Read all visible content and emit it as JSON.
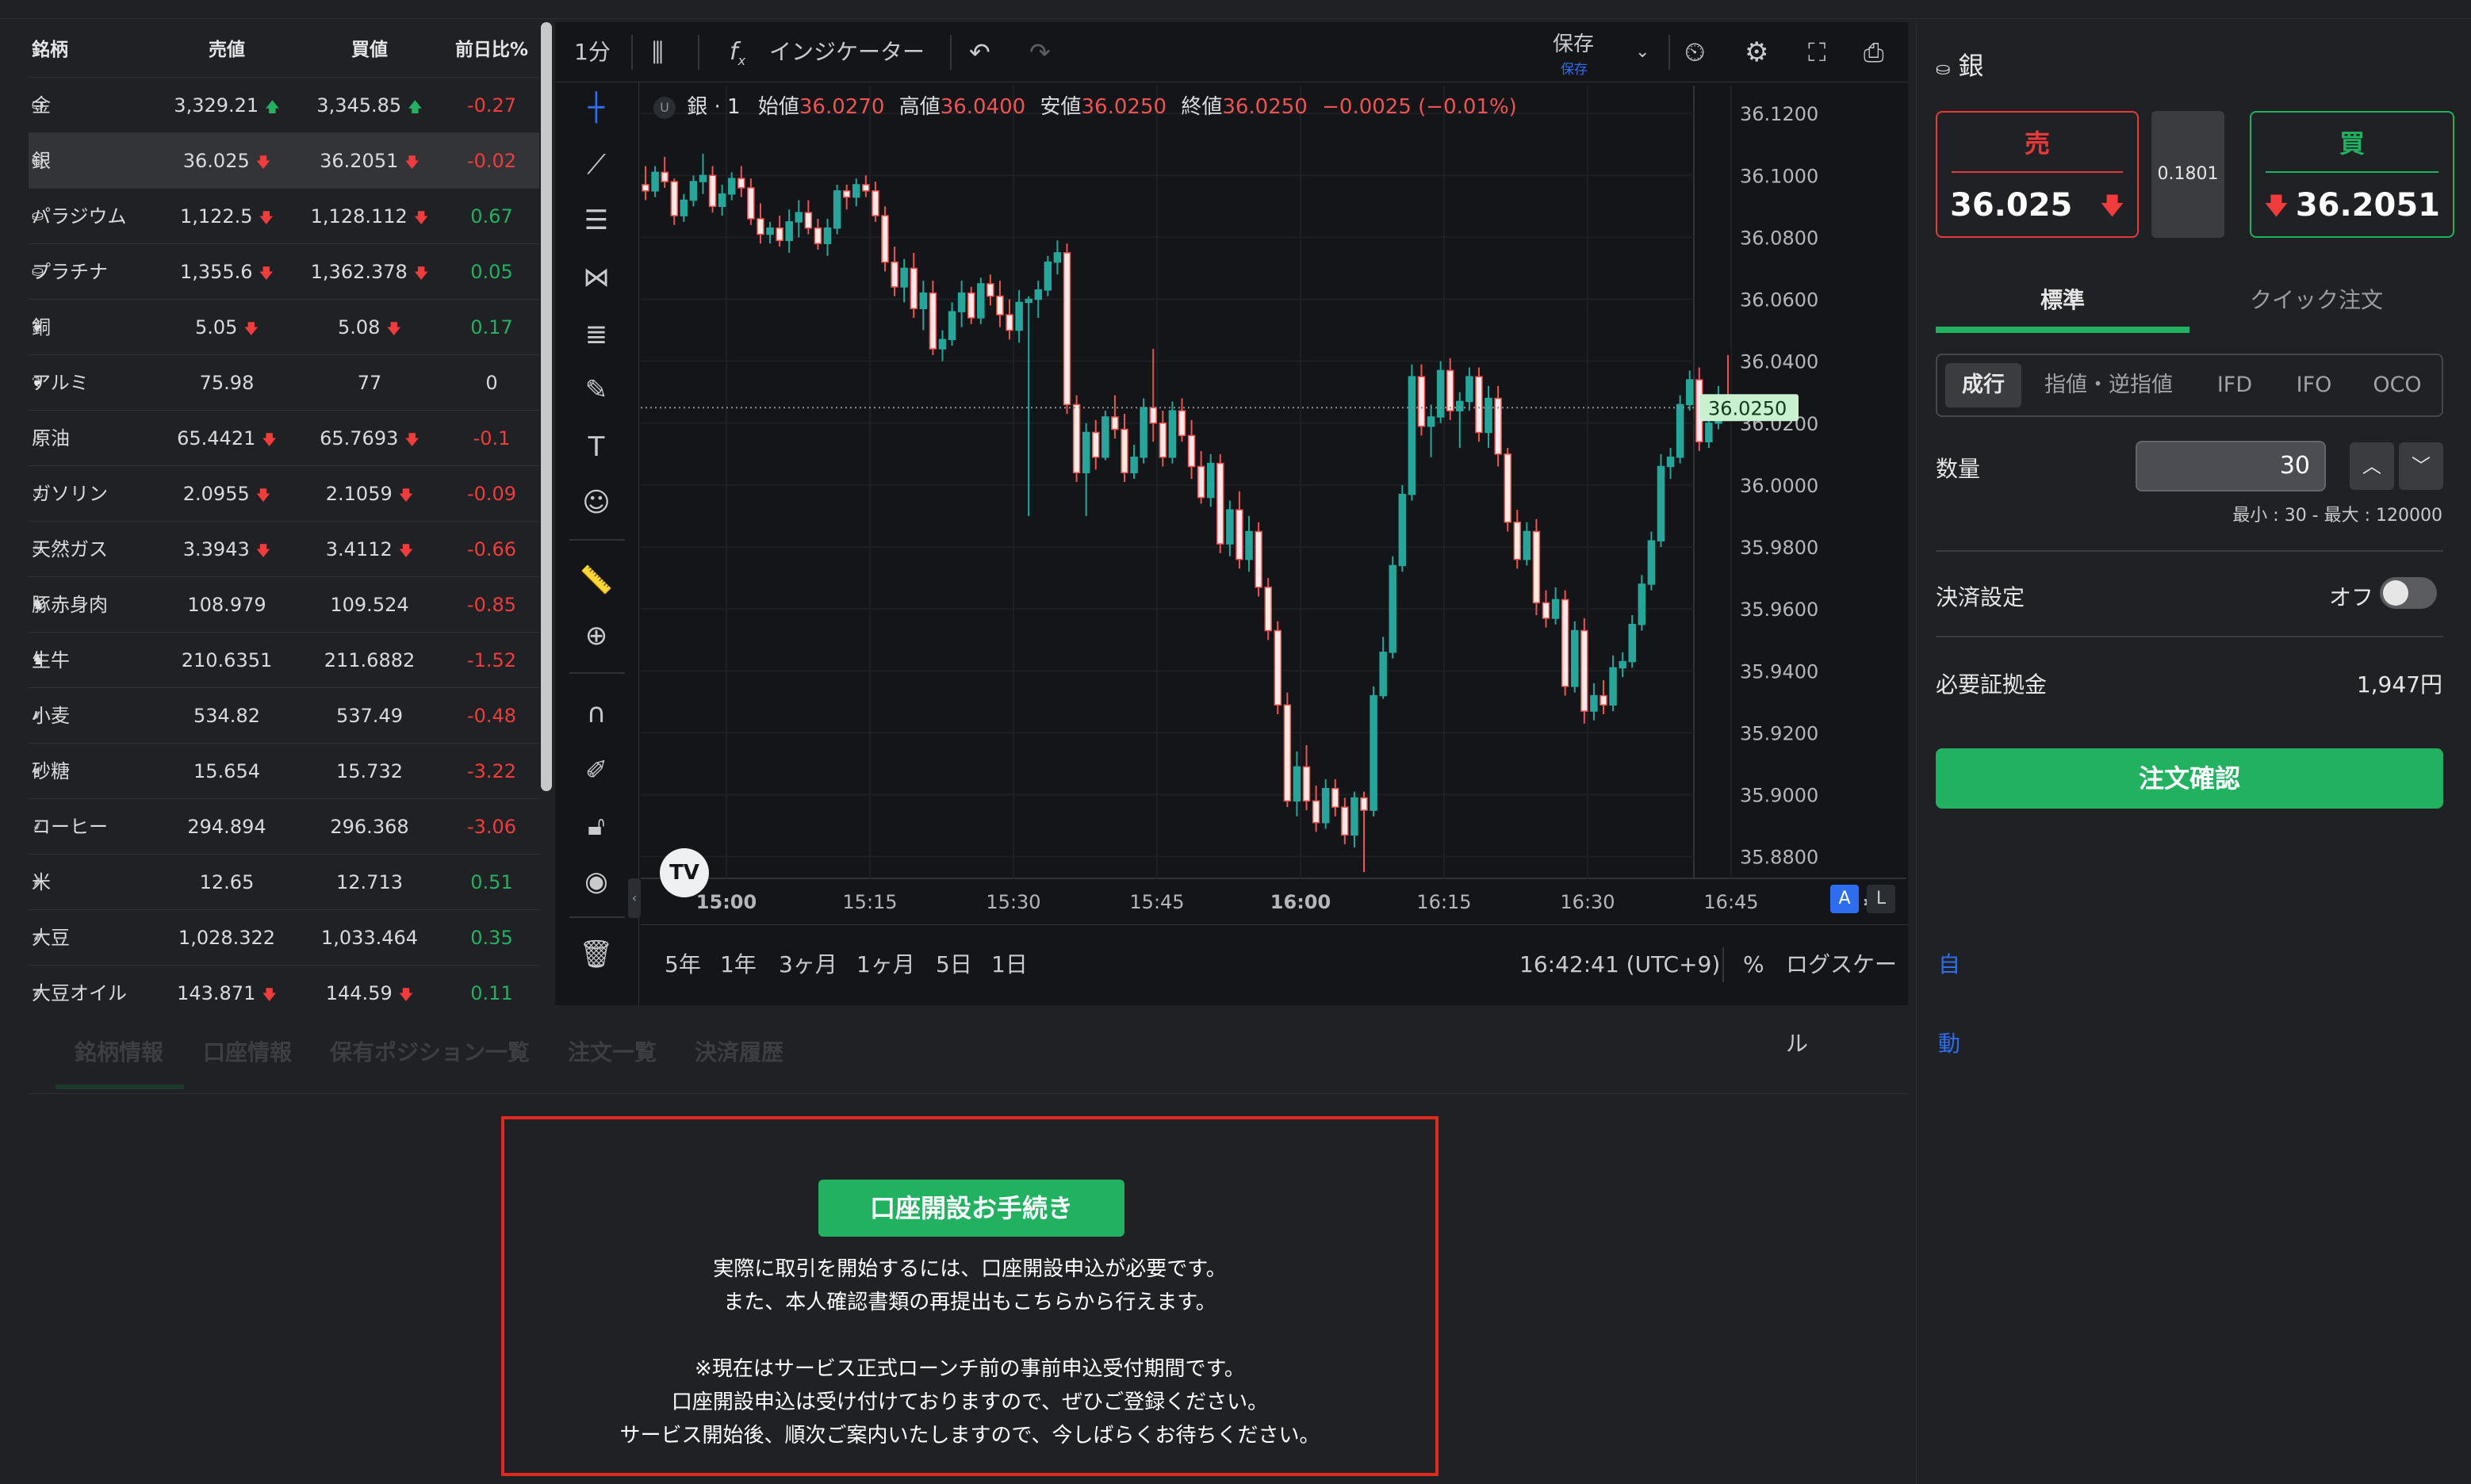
{
  "market": {
    "headers": {
      "name": "銘柄",
      "sell": "売値",
      "buy": "買値",
      "change": "前日比%"
    },
    "rows": [
      {
        "icon": "metal-icon",
        "glyph": "⛀",
        "name": "金",
        "sell": "3,329.21",
        "sell_dir": "▲",
        "buy": "3,345.85",
        "buy_dir": "▲",
        "change": "-0.27"
      },
      {
        "icon": "metal-icon",
        "glyph": "⛀",
        "name": "銀",
        "sell": "36.025",
        "sell_dir": "▼",
        "buy": "36.2051",
        "buy_dir": "▼",
        "change": "-0.02"
      },
      {
        "icon": "metal-icon",
        "glyph": "⛀",
        "name": "パラジウム",
        "sell": "1,122.5",
        "sell_dir": "▼",
        "buy": "1,128.112",
        "buy_dir": "▼",
        "change": "0.67"
      },
      {
        "icon": "metal-icon",
        "glyph": "⛀",
        "name": "プラチナ",
        "sell": "1,355.6",
        "sell_dir": "▼",
        "buy": "1,362.378",
        "buy_dir": "▼",
        "change": "0.05"
      },
      {
        "icon": "coil-icon",
        "glyph": "❦",
        "name": "銅",
        "sell": "5.05",
        "sell_dir": "▼",
        "buy": "5.08",
        "buy_dir": "▼",
        "change": "0.17"
      },
      {
        "icon": "coil-icon",
        "glyph": "❦",
        "name": "アルミ",
        "sell": "75.98",
        "sell_dir": "",
        "buy": "77",
        "buy_dir": "",
        "change": "0"
      },
      {
        "icon": "flame-icon",
        "glyph": "♨",
        "name": "原油",
        "sell": "65.4421",
        "sell_dir": "▼",
        "buy": "65.7693",
        "buy_dir": "▼",
        "change": "-0.1"
      },
      {
        "icon": "flame-icon",
        "glyph": "♨",
        "name": "ガソリン",
        "sell": "2.0955",
        "sell_dir": "▼",
        "buy": "2.1059",
        "buy_dir": "▼",
        "change": "-0.09"
      },
      {
        "icon": "flame-icon",
        "glyph": "♨",
        "name": "天然ガス",
        "sell": "3.3943",
        "sell_dir": "▼",
        "buy": "3.4112",
        "buy_dir": "▼",
        "change": "-0.66"
      },
      {
        "icon": "livestock-icon",
        "glyph": "♞",
        "name": "豚赤身肉",
        "sell": "108.979",
        "sell_dir": "",
        "buy": "109.524",
        "buy_dir": "",
        "change": "-0.85"
      },
      {
        "icon": "livestock-icon",
        "glyph": "♞",
        "name": "生牛",
        "sell": "210.6351",
        "sell_dir": "",
        "buy": "211.6882",
        "buy_dir": "",
        "change": "-1.52"
      },
      {
        "icon": "grain-icon",
        "glyph": "⸙",
        "name": "小麦",
        "sell": "534.82",
        "sell_dir": "",
        "buy": "537.49",
        "buy_dir": "",
        "change": "-0.48"
      },
      {
        "icon": "grain-icon",
        "glyph": "⸙",
        "name": "砂糖",
        "sell": "15.654",
        "sell_dir": "",
        "buy": "15.732",
        "buy_dir": "",
        "change": "-3.22"
      },
      {
        "icon": "grain-icon",
        "glyph": "⸙",
        "name": "コーヒー",
        "sell": "294.894",
        "sell_dir": "",
        "buy": "296.368",
        "buy_dir": "",
        "change": "-3.06"
      },
      {
        "icon": "grain-icon",
        "glyph": "⸙",
        "name": "米",
        "sell": "12.65",
        "sell_dir": "",
        "buy": "12.713",
        "buy_dir": "",
        "change": "0.51"
      },
      {
        "icon": "grain-icon",
        "glyph": "⸙",
        "name": "大豆",
        "sell": "1,028.322",
        "sell_dir": "",
        "buy": "1,033.464",
        "buy_dir": "",
        "change": "0.35"
      },
      {
        "icon": "grain-icon",
        "glyph": "⸙",
        "name": "大豆オイル",
        "sell": "143.871",
        "sell_dir": "▼",
        "buy": "144.59",
        "buy_dir": "▼",
        "change": "0.11"
      }
    ]
  },
  "chart_toolbar": {
    "interval": "1分",
    "indicator": "インジケーター",
    "save": "保存",
    "save_sub": "保存"
  },
  "chart_header": {
    "flag": "U",
    "symbol": "銀 · 1",
    "open_label": "始値",
    "open": "36.0270",
    "high_label": "高値",
    "high": "36.0400",
    "low_label": "安値",
    "low": "36.0250",
    "close_label": "終値",
    "close": "36.0250",
    "change": "−0.0025 (−0.01%)"
  },
  "chart_bottom": {
    "ranges": [
      "5年",
      "1年",
      "3ヶ月",
      "1ヶ月",
      "5日",
      "1日"
    ],
    "time": "16:42:41 (UTC+9)",
    "percent": "%",
    "log": "ログスケール",
    "auto": "自動",
    "scale_a": "A",
    "scale_l": "L"
  },
  "chart_data": {
    "type": "candlestick",
    "current_price": "36.0250",
    "y_ticks": [
      "36.1200",
      "36.1000",
      "36.0800",
      "36.0600",
      "36.0400",
      "36.0200",
      "36.0000",
      "35.9800",
      "35.9600",
      "35.9400",
      "35.9200",
      "35.9000",
      "35.8800"
    ],
    "x_ticks": [
      "15:00",
      "15:15",
      "15:30",
      "15:45",
      "16:00",
      "16:15",
      "16:30",
      "16:45"
    ],
    "ylim": [
      35.873,
      36.129
    ],
    "up_color": "#26a69a",
    "down_color": "#ef5350",
    "ohlc": [
      [
        36.097,
        36.103,
        36.092,
        36.095
      ],
      [
        36.095,
        36.103,
        36.093,
        36.101
      ],
      [
        36.101,
        36.106,
        36.096,
        36.098
      ],
      [
        36.098,
        36.099,
        36.084,
        36.087
      ],
      [
        36.087,
        36.094,
        36.085,
        36.092
      ],
      [
        36.092,
        36.1,
        36.09,
        36.098
      ],
      [
        36.098,
        36.107,
        36.094,
        36.1
      ],
      [
        36.1,
        36.103,
        36.088,
        36.09
      ],
      [
        36.09,
        36.097,
        36.087,
        36.094
      ],
      [
        36.094,
        36.101,
        36.092,
        36.099
      ],
      [
        36.099,
        36.103,
        36.093,
        36.096
      ],
      [
        36.096,
        36.099,
        36.084,
        36.086
      ],
      [
        36.086,
        36.091,
        36.078,
        36.081
      ],
      [
        36.081,
        36.085,
        36.078,
        36.083
      ],
      [
        36.083,
        36.087,
        36.077,
        36.079
      ],
      [
        36.079,
        36.089,
        36.075,
        36.085
      ],
      [
        36.085,
        36.092,
        36.08,
        36.088
      ],
      [
        36.088,
        36.092,
        36.081,
        36.083
      ],
      [
        36.083,
        36.086,
        36.076,
        36.078
      ],
      [
        36.078,
        36.086,
        36.074,
        36.083
      ],
      [
        36.083,
        36.097,
        36.081,
        36.095
      ],
      [
        36.095,
        36.097,
        36.089,
        36.093
      ],
      [
        36.093,
        36.099,
        36.09,
        36.097
      ],
      [
        36.097,
        36.1,
        36.093,
        36.095
      ],
      [
        36.095,
        36.098,
        36.085,
        36.087
      ],
      [
        36.087,
        36.09,
        36.069,
        36.072
      ],
      [
        36.072,
        36.077,
        36.061,
        36.064
      ],
      [
        36.064,
        36.073,
        36.059,
        36.07
      ],
      [
        36.07,
        36.075,
        36.054,
        36.057
      ],
      [
        36.057,
        36.066,
        36.05,
        36.062
      ],
      [
        36.062,
        36.066,
        36.042,
        36.044
      ],
      [
        36.044,
        36.05,
        36.04,
        36.047
      ],
      [
        36.047,
        36.059,
        36.045,
        36.056
      ],
      [
        36.056,
        36.066,
        36.051,
        36.062
      ],
      [
        36.062,
        36.064,
        36.052,
        36.054
      ],
      [
        36.054,
        36.067,
        36.052,
        36.065
      ],
      [
        36.065,
        36.068,
        36.058,
        36.061
      ],
      [
        36.061,
        36.066,
        36.051,
        36.055
      ],
      [
        36.055,
        36.06,
        36.047,
        36.05
      ],
      [
        36.05,
        36.063,
        36.046,
        36.059
      ],
      [
        36.059,
        36.061,
        35.99,
        36.06
      ],
      [
        36.06,
        36.066,
        36.054,
        36.063
      ],
      [
        36.063,
        36.074,
        36.061,
        36.072
      ],
      [
        36.072,
        36.079,
        36.068,
        36.075
      ],
      [
        36.075,
        36.078,
        36.023,
        36.026
      ],
      [
        36.026,
        36.029,
        36.001,
        36.004
      ],
      [
        36.004,
        36.02,
        35.99,
        36.017
      ],
      [
        36.017,
        36.021,
        36.005,
        36.009
      ],
      [
        36.009,
        36.024,
        36.008,
        36.022
      ],
      [
        36.022,
        36.029,
        36.015,
        36.018
      ],
      [
        36.018,
        36.023,
        36.001,
        36.004
      ],
      [
        36.004,
        36.013,
        36.002,
        36.009
      ],
      [
        36.009,
        36.028,
        36.007,
        36.025
      ],
      [
        36.025,
        36.044,
        36.014,
        36.02
      ],
      [
        36.02,
        36.024,
        36.006,
        36.009
      ],
      [
        36.009,
        36.027,
        36.007,
        36.024
      ],
      [
        36.024,
        36.028,
        36.014,
        36.016
      ],
      [
        36.016,
        36.021,
        36.002,
        36.006
      ],
      [
        36.006,
        36.011,
        35.994,
        35.996
      ],
      [
        35.996,
        36.01,
        35.993,
        36.007
      ],
      [
        36.007,
        36.01,
        35.978,
        35.981
      ],
      [
        35.981,
        35.995,
        35.977,
        35.992
      ],
      [
        35.992,
        35.998,
        35.973,
        35.976
      ],
      [
        35.976,
        35.99,
        35.972,
        35.985
      ],
      [
        35.985,
        35.988,
        35.964,
        35.967
      ],
      [
        35.967,
        35.97,
        35.95,
        35.953
      ],
      [
        35.953,
        35.956,
        35.926,
        35.929
      ],
      [
        35.929,
        35.933,
        35.896,
        35.898
      ],
      [
        35.898,
        35.914,
        35.893,
        35.909
      ],
      [
        35.909,
        35.916,
        35.895,
        35.898
      ],
      [
        35.898,
        35.903,
        35.888,
        35.891
      ],
      [
        35.891,
        35.905,
        35.889,
        35.902
      ],
      [
        35.902,
        35.905,
        35.893,
        35.896
      ],
      [
        35.896,
        35.899,
        35.884,
        35.887
      ],
      [
        35.887,
        35.901,
        35.883,
        35.899
      ],
      [
        35.899,
        35.901,
        35.875,
        35.895
      ],
      [
        35.895,
        35.935,
        35.893,
        35.932
      ],
      [
        35.932,
        35.951,
        35.931,
        35.946
      ],
      [
        35.946,
        35.977,
        35.944,
        35.974
      ],
      [
        35.974,
        36.0,
        35.972,
        35.997
      ],
      [
        35.997,
        36.039,
        35.995,
        36.035
      ],
      [
        36.035,
        36.039,
        36.016,
        36.019
      ],
      [
        36.019,
        36.026,
        36.009,
        36.022
      ],
      [
        36.022,
        36.04,
        36.02,
        36.037
      ],
      [
        36.037,
        36.041,
        36.021,
        36.024
      ],
      [
        36.024,
        36.03,
        36.012,
        36.027
      ],
      [
        36.027,
        36.038,
        36.024,
        36.035
      ],
      [
        36.035,
        36.038,
        36.014,
        36.017
      ],
      [
        36.017,
        36.032,
        36.012,
        36.028
      ],
      [
        36.028,
        36.032,
        36.006,
        36.01
      ],
      [
        36.01,
        36.012,
        35.985,
        35.988
      ],
      [
        35.988,
        35.992,
        35.973,
        35.976
      ],
      [
        35.976,
        35.988,
        35.974,
        35.985
      ],
      [
        35.985,
        35.989,
        35.958,
        35.962
      ],
      [
        35.962,
        35.966,
        35.954,
        35.957
      ],
      [
        35.957,
        35.967,
        35.955,
        35.963
      ],
      [
        35.963,
        35.966,
        35.932,
        35.935
      ],
      [
        35.935,
        35.956,
        35.933,
        35.953
      ],
      [
        35.953,
        35.957,
        35.923,
        35.927
      ],
      [
        35.927,
        35.936,
        35.924,
        35.932
      ],
      [
        35.932,
        35.937,
        35.926,
        35.929
      ],
      [
        35.929,
        35.945,
        35.927,
        35.941
      ],
      [
        35.941,
        35.946,
        35.938,
        35.943
      ],
      [
        35.943,
        35.958,
        35.941,
        35.955
      ],
      [
        35.955,
        35.971,
        35.953,
        35.968
      ],
      [
        35.968,
        35.985,
        35.966,
        35.982
      ],
      [
        35.982,
        36.01,
        35.98,
        36.006
      ],
      [
        36.006,
        36.012,
        36.002,
        36.009
      ],
      [
        36.009,
        36.029,
        36.007,
        36.026
      ],
      [
        36.026,
        36.037,
        36.024,
        36.034
      ],
      [
        36.034,
        36.038,
        36.011,
        36.014
      ],
      [
        36.014,
        36.023,
        36.012,
        36.02
      ],
      [
        36.02,
        36.032,
        36.018,
        36.029
      ],
      [
        36.029,
        36.042,
        36.025,
        36.025
      ]
    ]
  },
  "order": {
    "title": "銀",
    "sell_label": "売",
    "sell_price": "36.025",
    "buy_label": "買",
    "buy_price": "36.2051",
    "spread": "0.1801",
    "tab_standard": "標準",
    "tab_quick": "クイック注文",
    "types": [
      "成行",
      "指値・逆指値",
      "IFD",
      "IFO",
      "OCO"
    ],
    "qty_label": "数量",
    "qty_value": "30",
    "qty_range": "最小 : 30 - 最大 : 120000",
    "settle_label": "決済設定",
    "settle_value": "オフ",
    "margin_label": "必要証拠金",
    "margin_value": "1,947円",
    "confirm": "注文確認"
  },
  "bottom_tabs": [
    "銘柄情報",
    "口座情報",
    "保有ポジション一覧",
    "注文一覧",
    "決済履歴"
  ],
  "notice": {
    "button": "口座開設お手続き",
    "lines": [
      "実際に取引を開始するには、口座開設申込が必要です。",
      "また、本人確認書類の再提出もこちらから行えます。",
      "",
      "※現在はサービス正式ローンチ前の事前申込受付期間です。",
      "口座開設申込は受け付けておりますので、ぜひご登録ください。",
      "サービス開始後、順次ご案内いたしますので、今しばらくお待ちください。"
    ]
  }
}
